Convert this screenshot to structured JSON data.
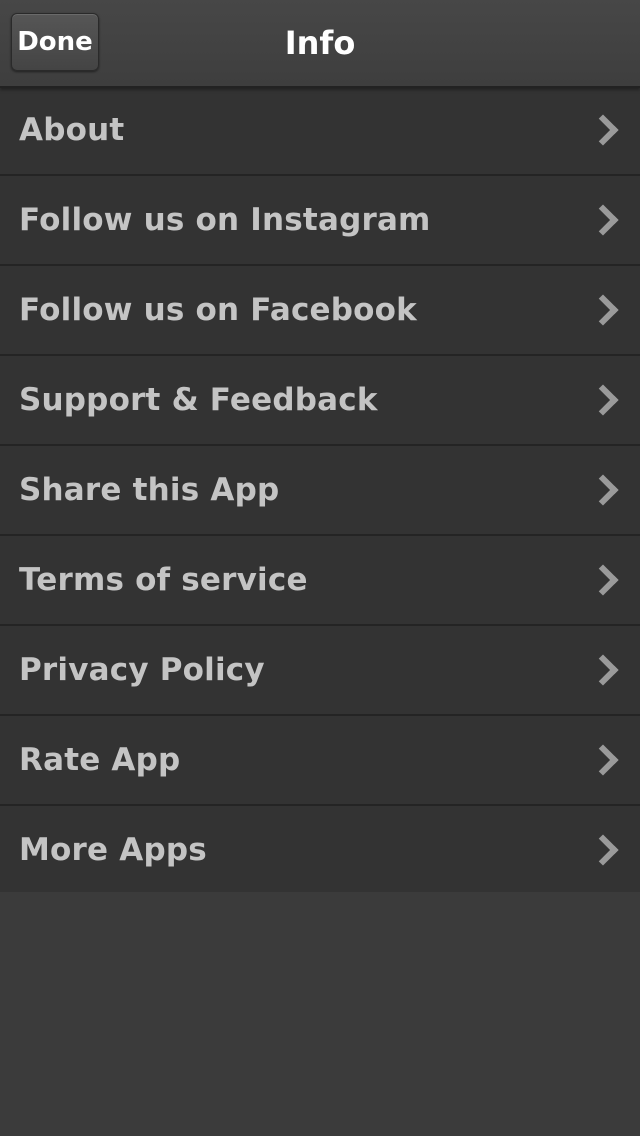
{
  "navbar": {
    "done_label": "Done",
    "title": "Info"
  },
  "menu": {
    "items": [
      {
        "label": "About",
        "icon": "chevron-right-icon"
      },
      {
        "label": "Follow us on Instagram",
        "icon": "chevron-right-icon"
      },
      {
        "label": "Follow us on Facebook",
        "icon": "chevron-right-icon"
      },
      {
        "label": "Support & Feedback",
        "icon": "chevron-right-icon"
      },
      {
        "label": "Share this App",
        "icon": "chevron-right-icon"
      },
      {
        "label": "Terms of service",
        "icon": "chevron-right-icon"
      },
      {
        "label": "Privacy Policy",
        "icon": "chevron-right-icon"
      },
      {
        "label": "Rate App",
        "icon": "chevron-right-icon"
      },
      {
        "label": "More Apps",
        "icon": "chevron-right-icon"
      }
    ]
  },
  "colors": {
    "background": "#3b3b3b",
    "row_background": "#333333",
    "label_text": "#c4c4c4",
    "title_text": "#ffffff",
    "chevron": "#9a9a9a"
  }
}
